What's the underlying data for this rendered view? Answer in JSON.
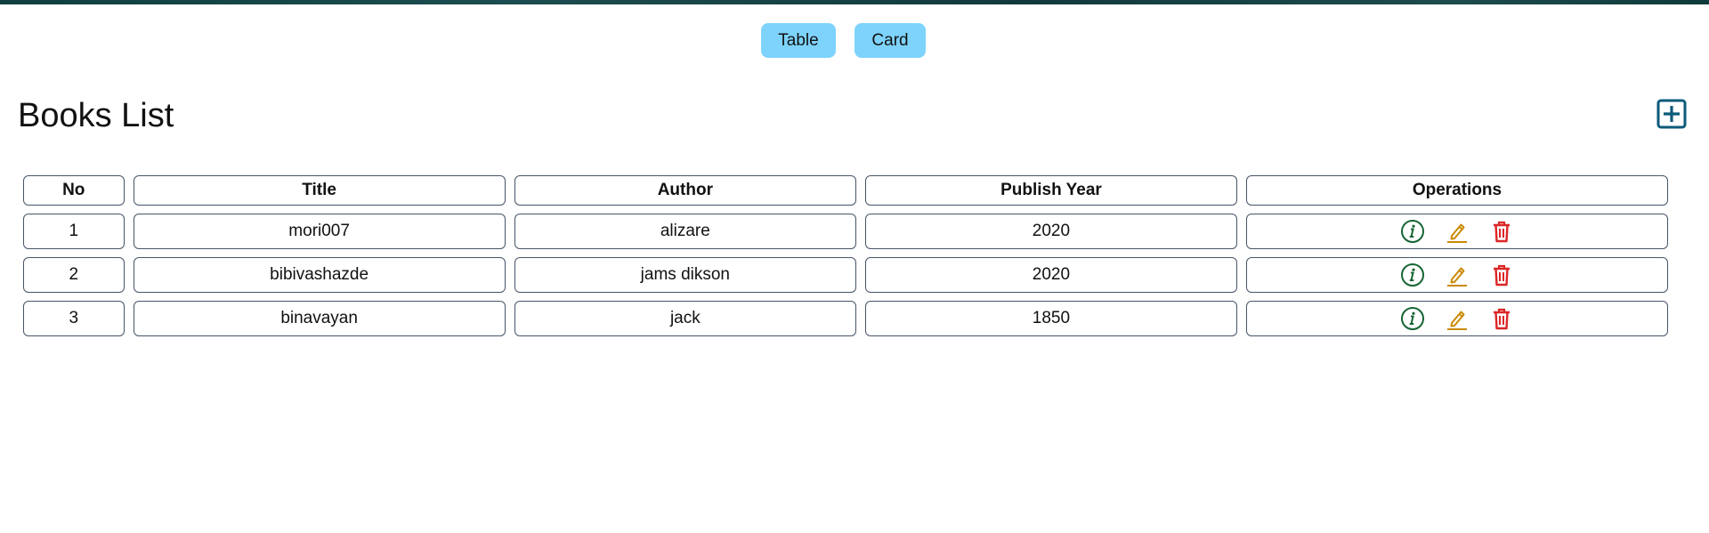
{
  "view_toggle": {
    "table_label": "Table",
    "card_label": "Card"
  },
  "page": {
    "title": "Books List",
    "add_icon": "plus-square-icon"
  },
  "table": {
    "headers": {
      "no": "No",
      "title": "Title",
      "author": "Author",
      "publish_year": "Publish Year",
      "operations": "Operations"
    },
    "rows": [
      {
        "no": "1",
        "title": "mori007",
        "author": "alizare",
        "publish_year": "2020"
      },
      {
        "no": "2",
        "title": "bibivashazde",
        "author": "jams dikson",
        "publish_year": "2020"
      },
      {
        "no": "3",
        "title": "binavayan",
        "author": "jack",
        "publish_year": "1850"
      }
    ],
    "operation_icons": [
      "info-circle-icon",
      "pencil-icon",
      "trash-icon"
    ]
  },
  "colors": {
    "toggle_bg": "#7dd3fc",
    "add_icon": "#0c5a7a",
    "info_icon": "#166534",
    "edit_icon": "#ca8a04",
    "delete_icon": "#dc2626",
    "cell_border": "#475569"
  }
}
